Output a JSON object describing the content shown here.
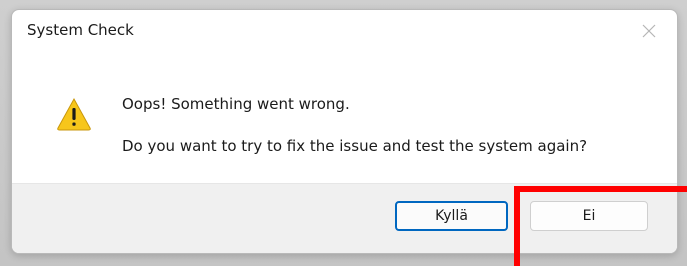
{
  "window": {
    "title": "System Check",
    "close_icon": "close-icon"
  },
  "message": {
    "icon": "warning-icon",
    "line1": "Oops! Something went wrong.",
    "line2": "Do you want to try to fix the issue and test the system again?"
  },
  "buttons": {
    "yes_label": "Kyllä",
    "no_label": "Ei"
  },
  "colors": {
    "accent": "#0067c0",
    "highlight": "#ff0000",
    "warning": "#f7c61b"
  }
}
